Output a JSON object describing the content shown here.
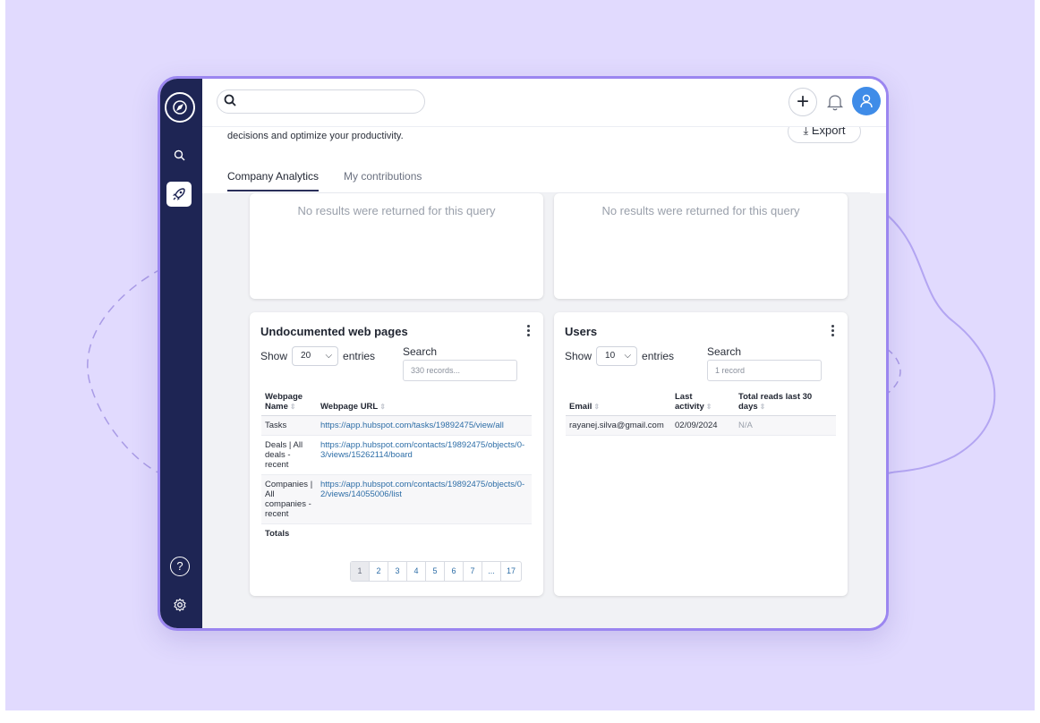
{
  "topbar": {
    "search_placeholder": "",
    "export_label": "Export"
  },
  "header": {
    "subtitle": "decisions and optimize your productivity."
  },
  "tabs": [
    {
      "label": "Company Analytics",
      "active": true
    },
    {
      "label": "My contributions",
      "active": false
    }
  ],
  "empty_cards": [
    {
      "message": "No results were returned for this query"
    },
    {
      "message": "No results were returned for this query"
    }
  ],
  "webpages": {
    "title": "Undocumented web pages",
    "show_label": "Show",
    "entries_label": "entries",
    "page_size": "20",
    "search_label": "Search",
    "search_placeholder": "330 records...",
    "columns": [
      "Webpage Name",
      "Webpage URL"
    ],
    "rows": [
      {
        "name": "Tasks",
        "url": "https://app.hubspot.com/tasks/19892475/view/all"
      },
      {
        "name": "Deals | All deals - recent",
        "url": "https://app.hubspot.com/contacts/19892475/objects/0-3/views/15262114/board"
      },
      {
        "name": "Companies | All companies - recent",
        "url": "https://app.hubspot.com/contacts/19892475/objects/0-2/views/14055006/list"
      }
    ],
    "totals_label": "Totals",
    "pages": [
      "1",
      "2",
      "3",
      "4",
      "5",
      "6",
      "7",
      "...",
      "17"
    ]
  },
  "users": {
    "title": "Users",
    "show_label": "Show",
    "entries_label": "entries",
    "page_size": "10",
    "search_label": "Search",
    "search_placeholder": "1 record",
    "columns": [
      "Email",
      "Last activity",
      "Total reads last 30 days"
    ],
    "rows": [
      {
        "email": "rayanej.silva@gmail.com",
        "last_activity": "02/09/2024",
        "reads": "N/A"
      }
    ]
  },
  "sidebar": {
    "help_glyph": "?",
    "icons": [
      "compass-logo-icon",
      "search-icon",
      "rocket-icon",
      "help-icon",
      "gear-icon"
    ]
  },
  "colors": {
    "backdrop": "#e1dafe",
    "frame_border": "#9b86f0",
    "sidebar": "#1e2554",
    "avatar": "#3f8ce8",
    "link": "#2e6ea7"
  }
}
